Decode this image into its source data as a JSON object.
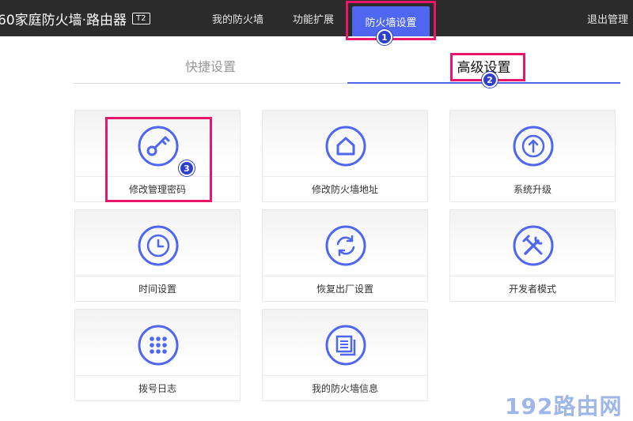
{
  "header": {
    "logo_text": "60家庭防火墙·路由器",
    "logo_tag": "T2",
    "nav": [
      {
        "label": "我的防火墙"
      },
      {
        "label": "功能扩展"
      },
      {
        "label": "防火墙设置"
      }
    ],
    "logout_label": "退出管理"
  },
  "tabs": [
    {
      "label": "快捷设置",
      "active": false
    },
    {
      "label": "高级设置",
      "active": true
    }
  ],
  "cards": [
    {
      "label": "修改管理密码",
      "icon": "key-icon"
    },
    {
      "label": "修改防火墙地址",
      "icon": "home-icon"
    },
    {
      "label": "系统升级",
      "icon": "arrow-up-icon"
    },
    {
      "label": "时间设置",
      "icon": "clock-icon"
    },
    {
      "label": "恢复出厂设置",
      "icon": "refresh-icon"
    },
    {
      "label": "开发者模式",
      "icon": "tools-icon"
    },
    {
      "label": "拨号日志",
      "icon": "dialpad-icon"
    },
    {
      "label": "我的防火墙信息",
      "icon": "document-icon"
    }
  ],
  "annotations": {
    "badges": [
      "1",
      "2",
      "3"
    ],
    "highlight_color": "#e8176c",
    "badge_color": "#2e3fcf"
  },
  "colors": {
    "accent": "#4e66f0",
    "header_bg": "#2b2b2b"
  },
  "watermark": "192路由网"
}
